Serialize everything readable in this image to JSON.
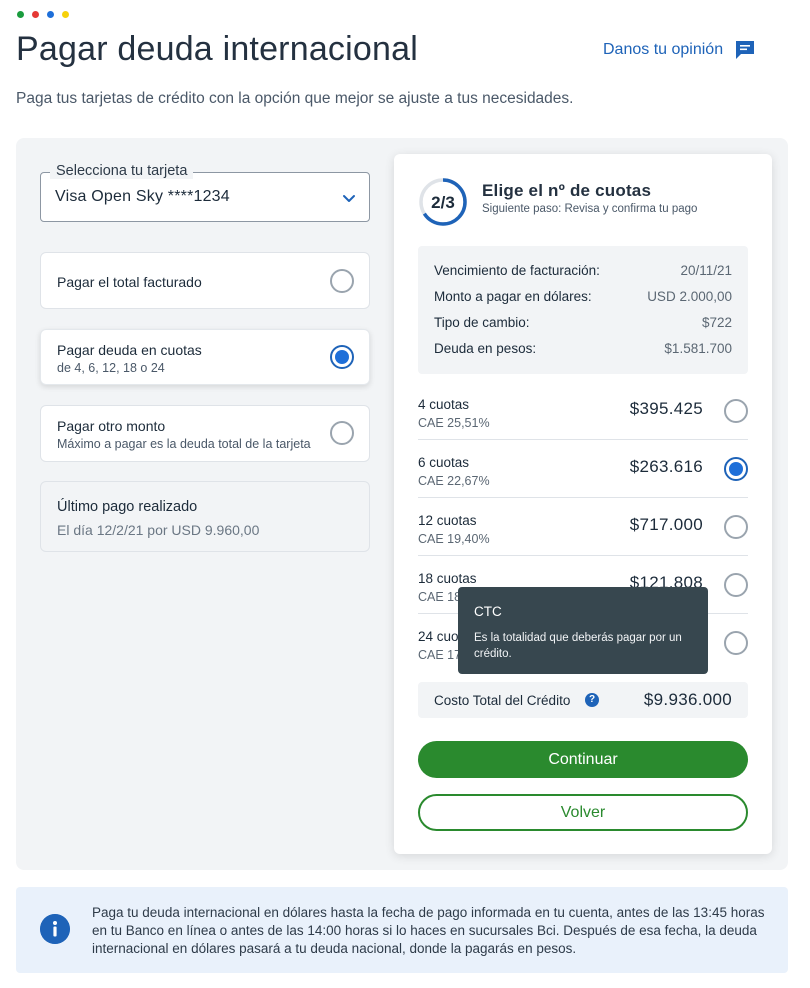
{
  "header": {
    "title": "Pagar deuda internacional",
    "feedback_link": "Danos tu opinión",
    "subtitle": "Paga tus tarjetas de crédito con la opción que mejor se ajuste a tus necesidades."
  },
  "card_select": {
    "label": "Selecciona tu tarjeta",
    "value": "Visa Open Sky ****1234"
  },
  "payment_options": [
    {
      "title": "Pagar el total facturado",
      "subtitle": "",
      "selected": false
    },
    {
      "title": "Pagar deuda en cuotas",
      "subtitle": "de 4, 6, 12, 18 o 24",
      "selected": true
    },
    {
      "title": "Pagar otro monto",
      "subtitle": "Máximo a pagar es la deuda total de la tarjeta",
      "selected": false
    }
  ],
  "last_payment": {
    "title": "Último pago realizado",
    "detail": "El día 12/2/21 por USD 9.960,00"
  },
  "stepper": {
    "step": "2/3",
    "progress": 0.66,
    "title": "Elige el nº de cuotas",
    "next": "Siguiente paso: Revisa y confirma tu pago"
  },
  "summary": [
    {
      "label": "Vencimiento de facturación:",
      "value": "20/11/21"
    },
    {
      "label": "Monto a pagar en dólares:",
      "value": "USD 2.000,00"
    },
    {
      "label": "Tipo de cambio:",
      "value": "$722"
    },
    {
      "label": "Deuda en pesos:",
      "value": "$1.581.700"
    }
  ],
  "installments": [
    {
      "count": "4 cuotas",
      "cae": "CAE 25,51%",
      "amount": "$395.425",
      "selected": false
    },
    {
      "count": "6 cuotas",
      "cae": "CAE 22,67%",
      "amount": "$263.616",
      "selected": true
    },
    {
      "count": "12 cuotas",
      "cae": "CAE 19,40%",
      "amount": "$717.000",
      "selected": false
    },
    {
      "count": "18 cuotas",
      "cae": "CAE 18",
      "amount": "$121.808",
      "selected": false
    },
    {
      "count": "24 cuo",
      "cae": "CAE 17",
      "amount": "",
      "selected": false
    }
  ],
  "ctc": {
    "label": "Costo Total del Crédito",
    "help_glyph": "?",
    "value": "$9.936.000"
  },
  "tooltip": {
    "title": "CTC",
    "text": "Es la totalidad que deberás pagar por un crédito."
  },
  "buttons": {
    "continue": "Continuar",
    "back": "Volver"
  },
  "notice": {
    "text": "Paga tu deuda internacional en dólares hasta la fecha de pago informada en tu cuenta, antes de las 13:45 horas en tu Banco en línea o antes de las 14:00 horas si lo haces en sucursales Bci. Después de esa fecha, la deuda internacional en dólares pasará a tu deuda nacional, donde la pagarás en pesos."
  },
  "colors": {
    "brand_blue": "#1e63b8",
    "primary_green": "#2a8a2e",
    "tooltip_bg": "#37474f",
    "dots": [
      "#1a9c3e",
      "#e53935",
      "#1e6fd9",
      "#f6d10a"
    ]
  }
}
